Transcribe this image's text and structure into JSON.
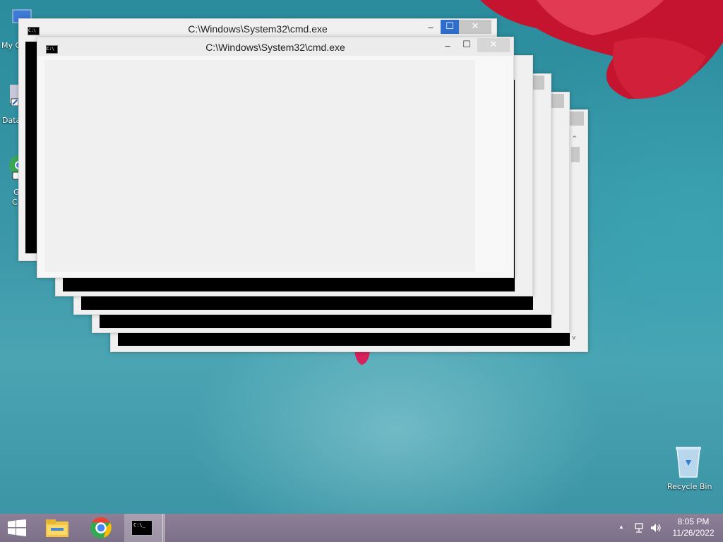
{
  "desktop": {
    "icons": [
      {
        "name": "my-computer",
        "label": "My C"
      },
      {
        "name": "data",
        "label": "Data"
      },
      {
        "name": "chrome-partial",
        "label_1": "G",
        "label_2": "C"
      },
      {
        "name": "recycle-bin",
        "label": "Recycle Bin"
      }
    ]
  },
  "windows": {
    "back_title": "C:\\Windows\\System32\\cmd.exe",
    "front_title": "C:\\Windows\\System32\\cmd.exe",
    "minimize_glyph": "‒",
    "maximize_glyph": "☐",
    "close_glyph": "✕"
  },
  "taskbar": {
    "start_icon": "windows-start-icon",
    "pinned": [
      "file-explorer-icon",
      "chrome-icon",
      "cmd-icon"
    ],
    "cmd_icon_text": "C:\\_"
  },
  "tray": {
    "time": "8:05 PM",
    "date": "11/26/2022",
    "chevron": "▲"
  }
}
